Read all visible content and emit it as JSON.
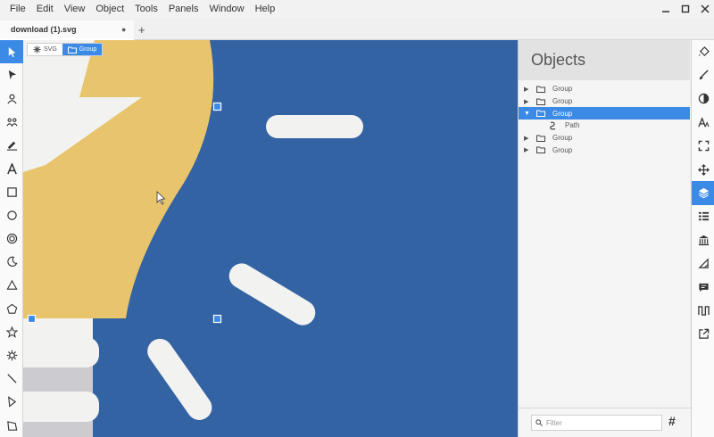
{
  "menubar": {
    "items": [
      "File",
      "Edit",
      "View",
      "Object",
      "Tools",
      "Panels",
      "Window",
      "Help"
    ]
  },
  "window_controls": [
    "minimize-icon",
    "maximize-icon",
    "close-icon"
  ],
  "tabs": {
    "document_name": "download (1).svg",
    "modified_marker": "●",
    "add_label": "+"
  },
  "breadcrumbs": [
    {
      "label": "SVG",
      "icon": "svg-root-icon",
      "active": false
    },
    {
      "label": "Group",
      "icon": "folder-icon",
      "active": true
    }
  ],
  "left_tools": [
    "select-tool-icon",
    "node-tool-icon",
    "user-tool-icon",
    "users-tool-icon",
    "pencil-tool-icon",
    "text-tool-icon",
    "rectangle-tool-icon",
    "circle-tool-icon",
    "ring-tool-icon",
    "crescent-tool-icon",
    "triangle-tool-icon",
    "pentagon-tool-icon",
    "star-tool-icon",
    "cog-tool-icon",
    "line-tool-icon",
    "polyline-tool-icon",
    "polygon-tool-icon"
  ],
  "panel": {
    "title": "Objects",
    "tree": [
      {
        "label": "Group",
        "expanded": false,
        "selected": false,
        "type": "group"
      },
      {
        "label": "Group",
        "expanded": false,
        "selected": false,
        "type": "group"
      },
      {
        "label": "Group",
        "expanded": true,
        "selected": true,
        "type": "group"
      },
      {
        "label": "Path",
        "expanded": false,
        "selected": false,
        "type": "path",
        "child": true
      },
      {
        "label": "Group",
        "expanded": false,
        "selected": false,
        "type": "group"
      },
      {
        "label": "Group",
        "expanded": false,
        "selected": false,
        "type": "group"
      }
    ],
    "filter_placeholder": "Filter",
    "hash_label": "#"
  },
  "right_tools": [
    "fill-icon",
    "stroke-icon",
    "contrast-icon",
    "typography-icon",
    "fullscreen-icon",
    "move-icon",
    "layers-icon",
    "list-icon",
    "library-icon",
    "triangle-ruler-icon",
    "comment-icon",
    "waveform-icon",
    "export-icon"
  ],
  "colors": {
    "accent": "#3b8ae6",
    "canvas_blue": "#3463a4",
    "shape_yellow": "#e8c46c",
    "shape_white": "#f2f2f0",
    "canvas_gray": "#c9c9c9"
  }
}
